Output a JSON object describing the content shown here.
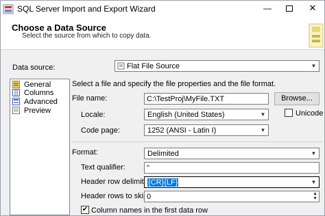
{
  "window": {
    "title": "SQL Server Import and Export Wizard"
  },
  "header": {
    "title": "Choose a Data Source",
    "subtitle": "Select the source from which to copy data."
  },
  "data_source": {
    "label": "Data source:",
    "value": "Flat File Source"
  },
  "nav": {
    "items": [
      {
        "label": "General",
        "icon": "general-icon"
      },
      {
        "label": "Columns",
        "icon": "columns-icon"
      },
      {
        "label": "Advanced",
        "icon": "advanced-icon"
      },
      {
        "label": "Preview",
        "icon": "preview-icon"
      }
    ]
  },
  "general": {
    "intro": "Select a file and specify the file properties and the file format.",
    "file_name": {
      "label": "File name:",
      "value": "C:\\TestProj\\MyFile.TXT",
      "browse": "Browse..."
    },
    "locale": {
      "label": "Locale:",
      "value": "English (United States)"
    },
    "unicode": {
      "label": "Unicode",
      "checked": false
    },
    "code_page": {
      "label": "Code page:",
      "value": "1252  (ANSI - Latin I)"
    },
    "format": {
      "label": "Format:",
      "value": "Delimited"
    },
    "text_qualifier": {
      "label": "Text qualifier:",
      "value": "\""
    },
    "header_row_delimiter": {
      "label": "Header row delimiter:",
      "value": "{CR}{LF}"
    },
    "header_rows_to_skip": {
      "label": "Header rows to skip:",
      "value": "0"
    },
    "column_names": {
      "label": "Column names in the first data row",
      "checked": true,
      "mark": "✔"
    }
  }
}
